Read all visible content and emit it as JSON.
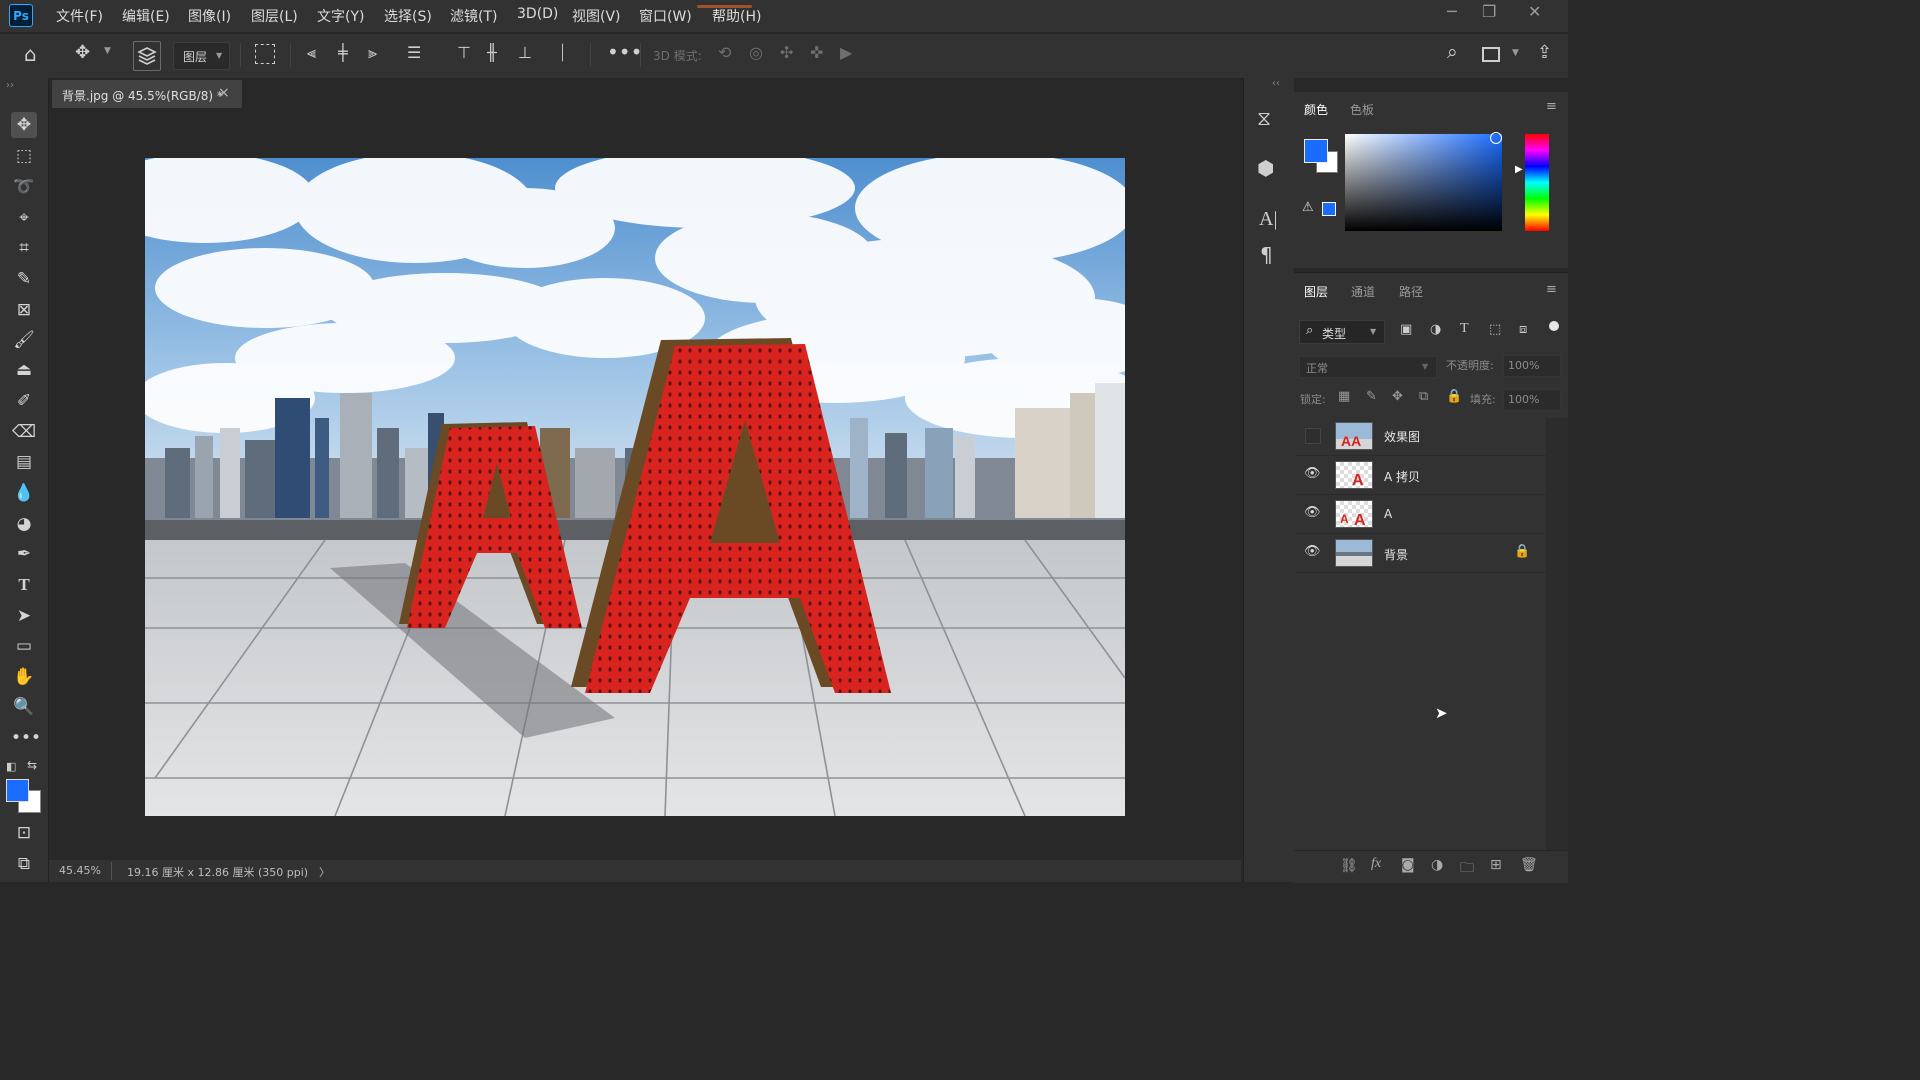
{
  "app": {
    "logo": "Ps"
  },
  "menu": [
    "文件(F)",
    "编辑(E)",
    "图像(I)",
    "图层(L)",
    "文字(Y)",
    "选择(S)",
    "滤镜(T)",
    "3D(D)",
    "视图(V)",
    "窗口(W)",
    "帮助(H)"
  ],
  "options": {
    "auto_select_target": "图层",
    "three_d_mode": "3D 模式:"
  },
  "document": {
    "tab_title": "背景.jpg @ 45.5%(RGB/8) *",
    "close": "×"
  },
  "status": {
    "zoom": "45.45%",
    "doc_size": "19.16 厘米 x 12.86 厘米 (350 ppi)",
    "arrow": "〉"
  },
  "color_panel": {
    "tabs": [
      "颜色",
      "色板"
    ],
    "foreground": "#1a6cff",
    "background": "#ffffff"
  },
  "layers_panel": {
    "tabs": [
      "图层",
      "通道",
      "路径"
    ],
    "filter_kind": "类型",
    "blend_mode": "正常",
    "opacity_label": "不透明度:",
    "opacity_value": "100%",
    "lock_label": "锁定:",
    "fill_label": "填充:",
    "fill_value": "100%",
    "layers": [
      {
        "name": "效果图",
        "visible": false,
        "locked": false
      },
      {
        "name": "A 拷贝",
        "visible": true,
        "locked": false
      },
      {
        "name": "A",
        "visible": true,
        "locked": false
      },
      {
        "name": "背景",
        "visible": true,
        "locked": true
      }
    ]
  },
  "colors": {
    "accent": "#1a6cff",
    "letter_red": "#d9231f",
    "panel_bg": "#323232",
    "app_bg": "#282828"
  }
}
